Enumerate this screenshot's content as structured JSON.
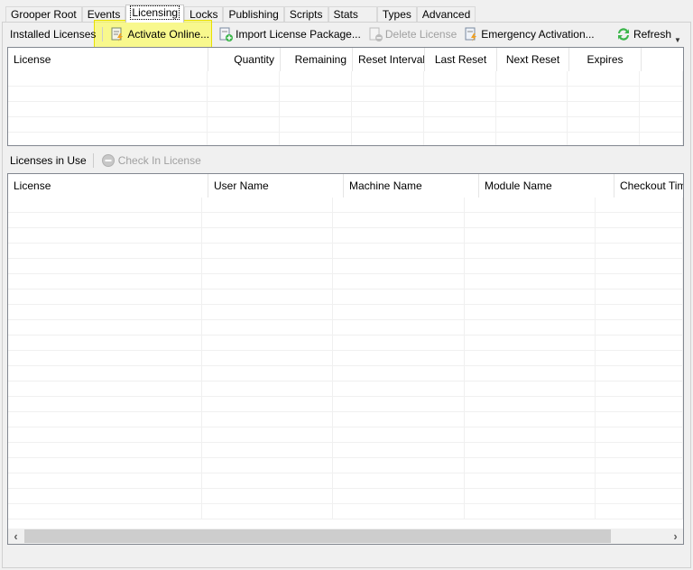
{
  "tabs": [
    "Grooper Root",
    "Events",
    "Licensing",
    "Locks",
    "Publishing",
    "Scripts",
    "Stats",
    "Types",
    "Advanced"
  ],
  "active_tab": "Licensing",
  "installed": {
    "label": "Installed Licenses",
    "activate": "Activate Online...",
    "import": "Import License Package...",
    "delete": "Delete License",
    "emergency": "Emergency Activation...",
    "refresh": "Refresh",
    "columns": [
      "License",
      "Quantity",
      "Remaining",
      "Reset Interval",
      "Last Reset",
      "Next Reset",
      "Expires",
      ""
    ]
  },
  "in_use": {
    "label": "Licenses in Use",
    "checkin": "Check In License",
    "columns": [
      "License",
      "User Name",
      "Machine Name",
      "Module Name",
      "Checkout Time"
    ]
  },
  "colors": {
    "highlight": "#ffff3c",
    "refresh_icon": "#3bb54a"
  }
}
